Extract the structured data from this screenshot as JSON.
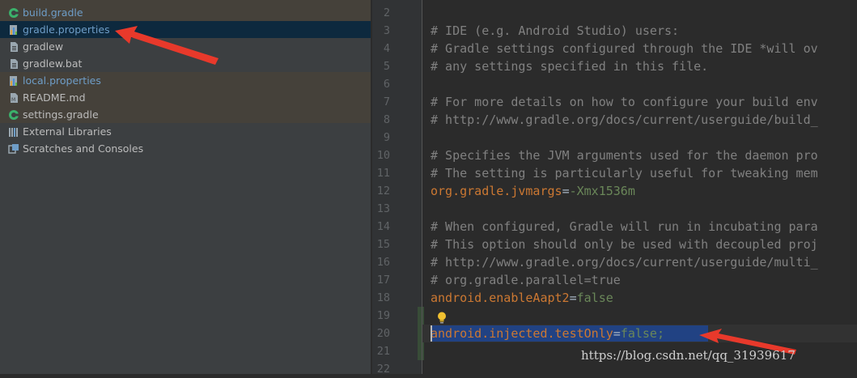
{
  "project_tree": {
    "items": [
      {
        "label": "build.gradle",
        "icon": "gradle-icon",
        "style": "tinted blue"
      },
      {
        "label": "gradle.properties",
        "icon": "properties-file-icon",
        "style": "selected blue"
      },
      {
        "label": "gradlew",
        "icon": "file-icon",
        "style": ""
      },
      {
        "label": "gradlew.bat",
        "icon": "file-icon",
        "style": ""
      },
      {
        "label": "local.properties",
        "icon": "properties-file-icon",
        "style": "tinted blue"
      },
      {
        "label": "README.md",
        "icon": "markdown-file-icon",
        "style": "tinted"
      },
      {
        "label": "settings.gradle",
        "icon": "gradle-icon",
        "style": "tinted"
      },
      {
        "label": "External Libraries",
        "icon": "libraries-icon",
        "style": ""
      },
      {
        "label": "Scratches and Consoles",
        "icon": "scratches-icon",
        "style": ""
      }
    ]
  },
  "editor": {
    "lines": [
      {
        "num": "2",
        "type": "comment",
        "text": ""
      },
      {
        "num": "3",
        "type": "comment",
        "text": "# IDE (e.g. Android Studio) users:"
      },
      {
        "num": "4",
        "type": "comment",
        "text": "# Gradle settings configured through the IDE *will ov"
      },
      {
        "num": "5",
        "type": "comment",
        "text": "# any settings specified in this file."
      },
      {
        "num": "6",
        "type": "comment",
        "text": ""
      },
      {
        "num": "7",
        "type": "comment",
        "text": "# For more details on how to configure your build env"
      },
      {
        "num": "8",
        "type": "comment",
        "text": "# http://www.gradle.org/docs/current/userguide/build_"
      },
      {
        "num": "9",
        "type": "comment",
        "text": ""
      },
      {
        "num": "10",
        "type": "comment",
        "text": "# Specifies the JVM arguments used for the daemon pro"
      },
      {
        "num": "11",
        "type": "comment",
        "text": "# The setting is particularly useful for tweaking mem"
      },
      {
        "num": "12",
        "type": "prop",
        "key": "org.gradle.jvmargs",
        "eq": "=",
        "value": "-Xmx1536m"
      },
      {
        "num": "13",
        "type": "comment",
        "text": ""
      },
      {
        "num": "14",
        "type": "comment",
        "text": "# When configured, Gradle will run in incubating para"
      },
      {
        "num": "15",
        "type": "comment",
        "text": "# This option should only be used with decoupled proj"
      },
      {
        "num": "16",
        "type": "comment",
        "text": "# http://www.gradle.org/docs/current/userguide/multi_"
      },
      {
        "num": "17",
        "type": "comment",
        "text": "# org.gradle.parallel=true"
      },
      {
        "num": "18",
        "type": "prop",
        "key": "android.enableAapt2",
        "eq": "=",
        "value": "false"
      },
      {
        "num": "19",
        "type": "comment",
        "text": ""
      },
      {
        "num": "20",
        "type": "prop",
        "key": "android.injected.testOnly",
        "eq": "=",
        "value": "false;"
      },
      {
        "num": "21",
        "type": "comment",
        "text": ""
      },
      {
        "num": "22",
        "type": "comment",
        "text": ""
      }
    ],
    "intention_icon": "lightbulb-icon"
  },
  "annotations": {
    "arrow_color": "#e8392b",
    "watermark": "https://blog.csdn.net/qq_31939617"
  },
  "colors": {
    "tree_bg": "#3c3f41",
    "selection": "#0d293e",
    "comment": "#808080",
    "key": "#cc7832",
    "value": "#6a8759"
  }
}
